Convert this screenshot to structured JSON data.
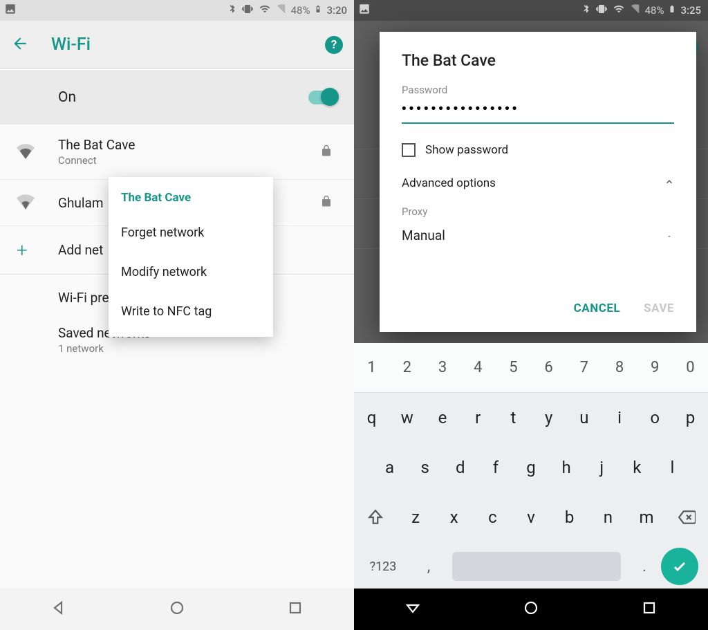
{
  "left": {
    "status": {
      "battery": "48%",
      "time": "3:20"
    },
    "toolbar": {
      "title": "Wi-Fi"
    },
    "on": {
      "label": "On"
    },
    "networks": [
      {
        "ssid": "The Bat Cave",
        "status": "Connect"
      },
      {
        "ssid": "Ghulam"
      }
    ],
    "add": {
      "label": "Add net"
    },
    "prefs": [
      {
        "primary": "Wi-Fi preferences"
      },
      {
        "primary": "Saved networks",
        "secondary": "1 network"
      }
    ],
    "popup": {
      "title": "The Bat Cave",
      "items": [
        "Forget network",
        "Modify network",
        "Write to NFC tag"
      ]
    }
  },
  "right": {
    "status": {
      "battery": "48%",
      "time": "3:25"
    },
    "dialog": {
      "title": "The Bat Cave",
      "password_label": "Password",
      "password_value": "••••••••••••••••",
      "show_password": "Show password",
      "advanced": "Advanced options",
      "proxy_label": "Proxy",
      "proxy_value": "Manual",
      "cancel": "CANCEL",
      "save": "SAVE"
    },
    "keyboard": {
      "row0": [
        "1",
        "2",
        "3",
        "4",
        "5",
        "6",
        "7",
        "8",
        "9",
        "0"
      ],
      "row1": [
        "q",
        "w",
        "e",
        "r",
        "t",
        "y",
        "u",
        "i",
        "o",
        "p"
      ],
      "row2": [
        "a",
        "s",
        "d",
        "f",
        "g",
        "h",
        "j",
        "k",
        "l"
      ],
      "row3": [
        "z",
        "x",
        "c",
        "v",
        "b",
        "n",
        "m"
      ],
      "symbols": "?123",
      "comma": ",",
      "dot": "."
    }
  }
}
